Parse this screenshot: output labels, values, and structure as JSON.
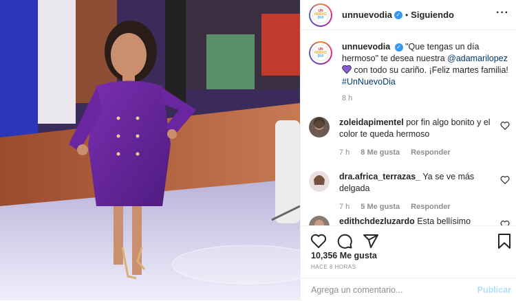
{
  "post": {
    "account": {
      "username": "unnuevodia",
      "verified_mark": "✓",
      "follow_status": "Siguiendo",
      "logo_lines": [
        "UN",
        "NUEVO",
        "DIA"
      ]
    },
    "caption": {
      "username": "unnuevodia",
      "text_before_mention": "\"Que tengas un día hermoso\" te desea nuestra ",
      "mention": "@adamarilopez",
      "text_after_heart": " con todo su cariño. ¡Feliz martes familia! ",
      "hashtag": "#UnNuevoDia",
      "time": "8 h"
    },
    "comments": [
      {
        "username": "zoleidapimentel",
        "text": " por fin algo bonito y el color te queda hermoso",
        "time": "7 h",
        "likes": "8 Me gusta",
        "reply": "Responder"
      },
      {
        "username": "dra.africa_terrazas_",
        "text": " Ya se ve más delgada",
        "time": "7 h",
        "likes": "5 Me gusta",
        "reply": "Responder"
      },
      {
        "username": "edithchdezluzardo",
        "text": " Esta bellísimo"
      }
    ],
    "likes_count": "10,356 Me gusta",
    "posted_ago": "HACE 8 HORAS",
    "comment_input": {
      "placeholder": "Agrega un comentario...",
      "publish_label": "Publicar"
    }
  },
  "colors": {
    "accent_blue": "#3897f0",
    "link_blue": "#00376b",
    "muted_gray": "#8e8e8e",
    "publish_disabled": "#b2dffc",
    "heart_purple": "#8a5cd0"
  },
  "icons": [
    "more-icon",
    "like-icon",
    "comment-icon",
    "share-icon",
    "save-icon",
    "comment-like-icon",
    "verified-icon",
    "purple-heart-icon"
  ]
}
